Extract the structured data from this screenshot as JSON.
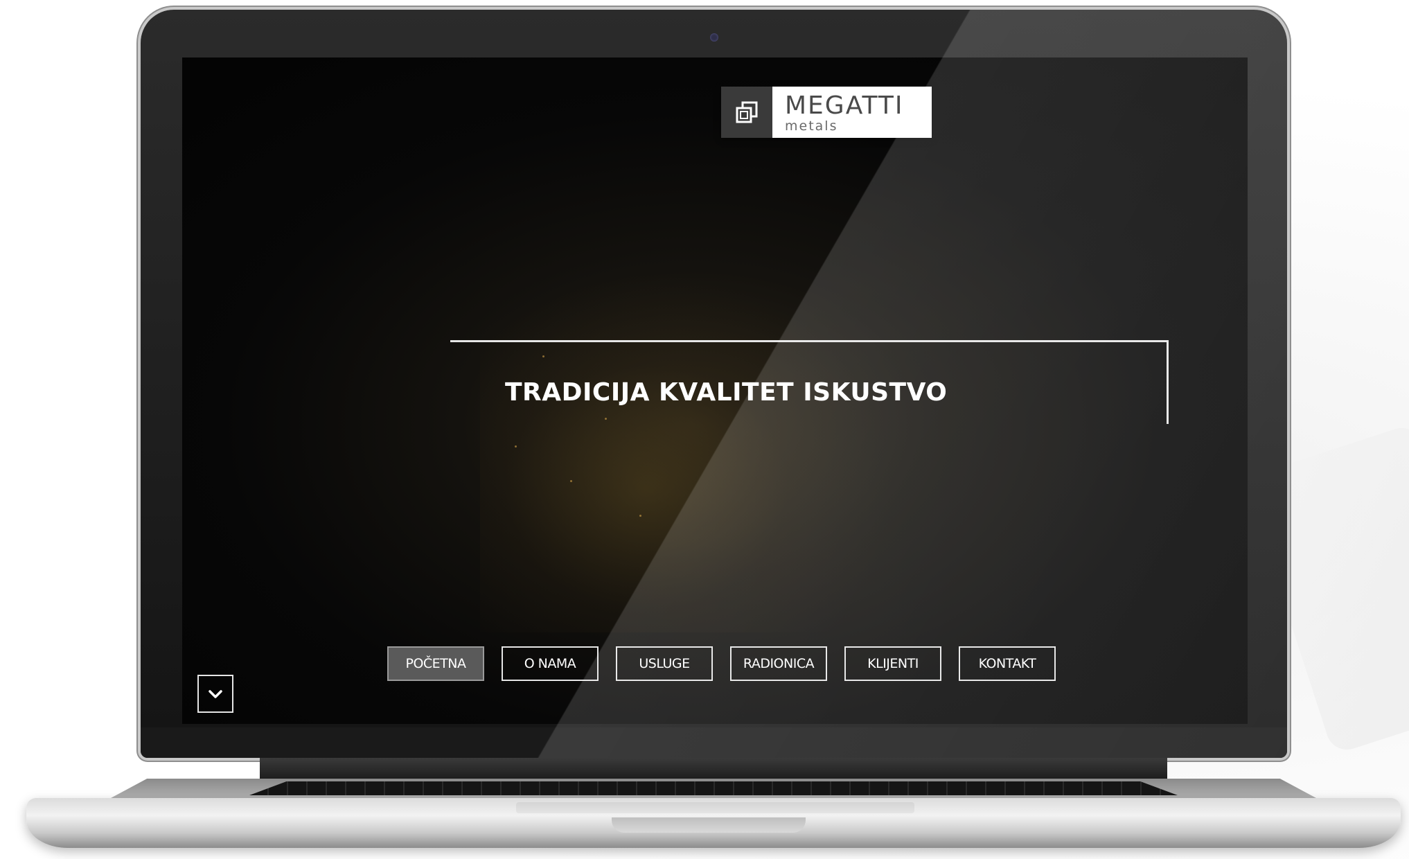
{
  "logo": {
    "name": "MEGATTI",
    "sub": "metals",
    "mark_icon": "megatti-logo-icon"
  },
  "hero": {
    "title": "TRADICIJA KVALITET ISKUSTVO"
  },
  "nav": {
    "items": [
      {
        "label": "POČETNA",
        "active": true
      },
      {
        "label": "O NAMA",
        "active": false
      },
      {
        "label": "USLUGE",
        "active": false
      },
      {
        "label": "RADIONICA",
        "active": false
      },
      {
        "label": "KLIJENTI",
        "active": false
      },
      {
        "label": "KONTAKT",
        "active": false
      }
    ]
  },
  "scroll_button": {
    "icon": "chevron-down-icon"
  },
  "colors": {
    "screen_bg": "#050505",
    "accent_line": "#e6e6e6",
    "active_nav_bg": "#5a5a5a",
    "logo_mark_bg": "#3a3a3a"
  }
}
